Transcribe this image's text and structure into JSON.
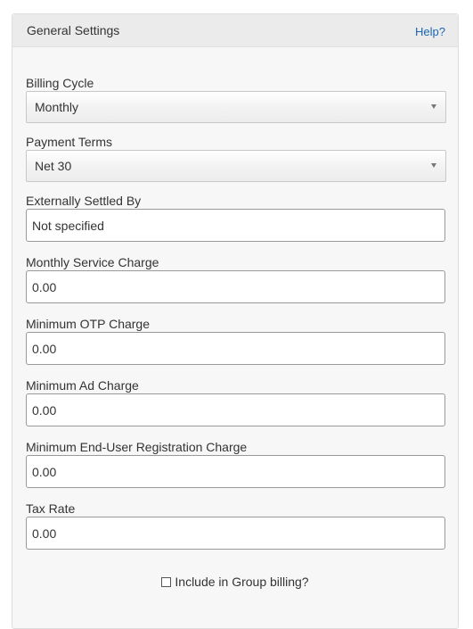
{
  "panel": {
    "title": "General Settings",
    "help_label": "Help?"
  },
  "fields": {
    "billing_cycle": {
      "label": "Billing Cycle",
      "value": "Monthly"
    },
    "payment_terms": {
      "label": "Payment Terms",
      "value": "Net 30"
    },
    "externally_settled_by": {
      "label": "Externally Settled By",
      "value": "Not specified"
    },
    "monthly_service_charge": {
      "label": "Monthly Service Charge",
      "value": "0.00"
    },
    "minimum_otp_charge": {
      "label": "Minimum OTP Charge",
      "value": "0.00"
    },
    "minimum_ad_charge": {
      "label": "Minimum Ad Charge",
      "value": "0.00"
    },
    "minimum_end_user_registration_charge": {
      "label": "Minimum End-User Registration Charge",
      "value": "0.00"
    },
    "tax_rate": {
      "label": "Tax Rate",
      "value": "0.00"
    }
  },
  "group_billing": {
    "label": "Include in Group billing?",
    "checked": false
  },
  "colors": {
    "link": "#1a66b3",
    "panel_bg": "#f7f7f7",
    "header_bg": "#ebebeb"
  }
}
